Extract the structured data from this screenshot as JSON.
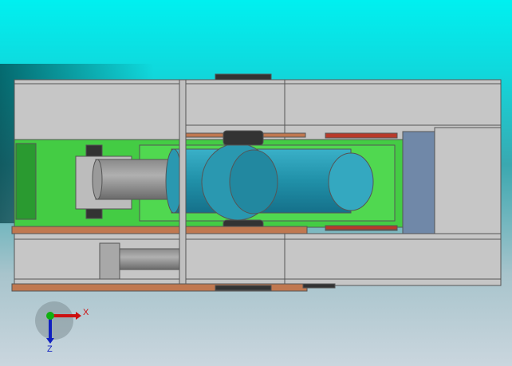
{
  "viewport": {
    "model": "hydraulic-cylinder-assembly",
    "view_orientation": "top"
  },
  "triad": {
    "x_label": "X",
    "z_label": "Z",
    "x_color": "#cc1010",
    "z_color": "#1020c0",
    "y_color": "#10b010"
  },
  "colors": {
    "frame": "#c6c6c6",
    "green_housing": "#44cc44",
    "cylinder": "#2a98b0",
    "copper": "#c07850",
    "blue_plate": "#7088a8"
  }
}
